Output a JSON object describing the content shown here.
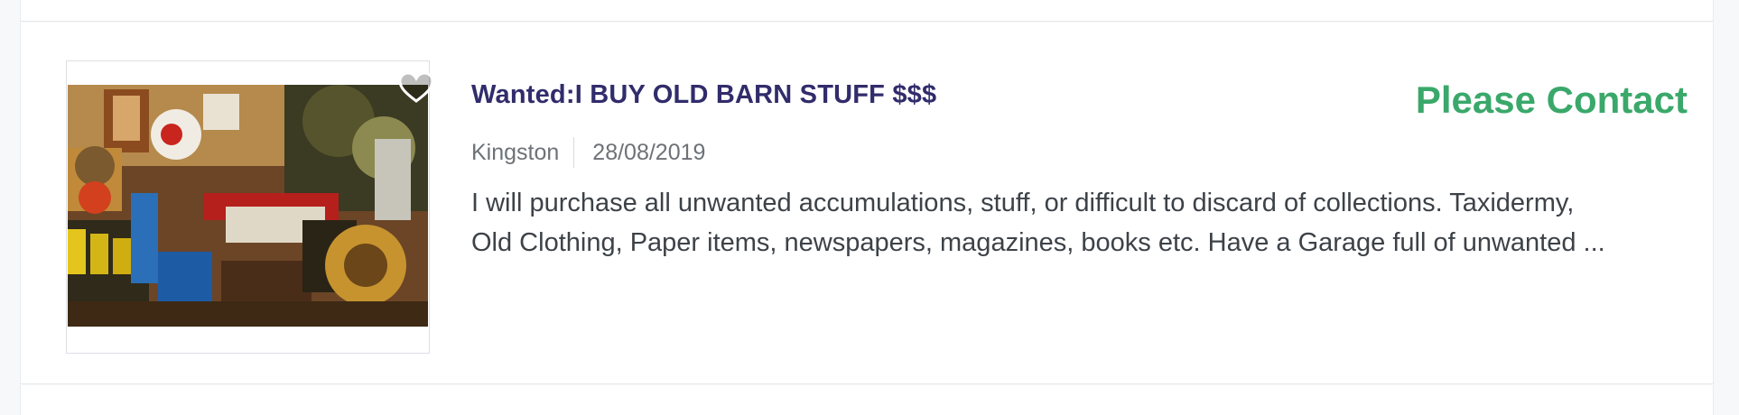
{
  "listing": {
    "title": "Wanted:I BUY OLD BARN STUFF $$$",
    "price": "Please Contact",
    "location": "Kingston",
    "date": "28/08/2019",
    "description_lines": [
      "I will purchase all unwanted accumulations, stuff, or difficult to discard of collections. Taxidermy,",
      "Old Clothing, Paper items, newspapers, magazines, books etc. Have a Garage full of unwanted ..."
    ],
    "thumbnail_alt": "antique shop interior",
    "favorite_icon": "heart-icon"
  },
  "colors": {
    "title": "#312c6b",
    "price": "#3aa86a",
    "meta": "#6d7278",
    "description": "#3d4248"
  }
}
